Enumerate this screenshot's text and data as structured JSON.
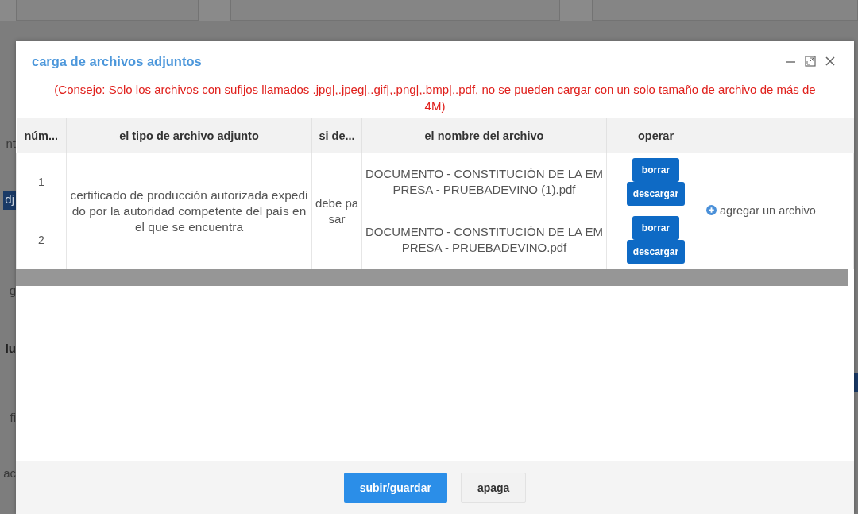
{
  "background": {
    "left_fragments": [
      {
        "text": "nt",
        "kind": "text"
      },
      {
        "text": "dj",
        "kind": "tag"
      },
      {
        "text": "g",
        "kind": "text"
      },
      {
        "text": "lu",
        "kind": "bold"
      },
      {
        "text": "fi",
        "kind": "text"
      },
      {
        "text": "ac",
        "kind": "text"
      }
    ]
  },
  "dialog": {
    "title": "carga de archivos adjuntos",
    "hint": "(Consejo: Solo los archivos con sufijos llamados .jpg|,.jpeg|,.gif|,.png|,.bmp|,.pdf, no se pueden cargar con un solo tamaño de archivo de más de 4M)",
    "table": {
      "columns": [
        "núm...",
        "el tipo de archivo adjunto",
        "si de...",
        "el nombre del archivo",
        "operar"
      ],
      "attachment_type": "certificado de producción autorizada expedido por la autoridad competente del país en el que se encuentra",
      "requirement": "debe pasar",
      "rows": [
        {
          "number": "1",
          "file_name": "DOCUMENTO - CONSTITUCIÓN DE LA EMPRESA - PRUEBADEVINO (1).pdf",
          "actions": [
            "borrar",
            "descargar"
          ]
        },
        {
          "number": "2",
          "file_name": "DOCUMENTO - CONSTITUCIÓN DE LA EMPRESA - PRUEBADEVINO.pdf",
          "actions": [
            "borrar",
            "descargar"
          ]
        }
      ],
      "add_link": "agregar un archivo"
    },
    "buttons": [
      {
        "label": "subir/guardar",
        "kind": "primary"
      },
      {
        "label": "apaga",
        "kind": "secondary"
      }
    ]
  }
}
